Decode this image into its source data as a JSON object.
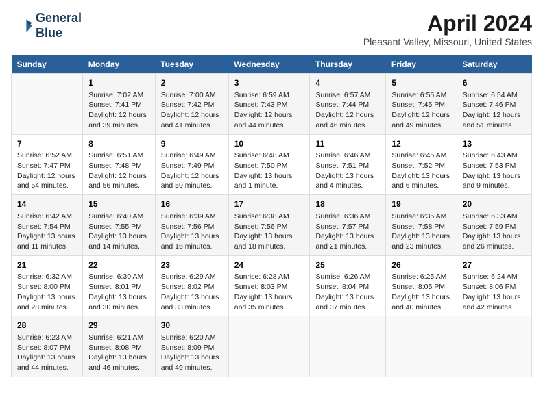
{
  "logo": {
    "line1": "General",
    "line2": "Blue"
  },
  "title": "April 2024",
  "subtitle": "Pleasant Valley, Missouri, United States",
  "headers": [
    "Sunday",
    "Monday",
    "Tuesday",
    "Wednesday",
    "Thursday",
    "Friday",
    "Saturday"
  ],
  "weeks": [
    [
      {
        "day": "",
        "sunrise": "",
        "sunset": "",
        "daylight": ""
      },
      {
        "day": "1",
        "sunrise": "Sunrise: 7:02 AM",
        "sunset": "Sunset: 7:41 PM",
        "daylight": "Daylight: 12 hours and 39 minutes."
      },
      {
        "day": "2",
        "sunrise": "Sunrise: 7:00 AM",
        "sunset": "Sunset: 7:42 PM",
        "daylight": "Daylight: 12 hours and 41 minutes."
      },
      {
        "day": "3",
        "sunrise": "Sunrise: 6:59 AM",
        "sunset": "Sunset: 7:43 PM",
        "daylight": "Daylight: 12 hours and 44 minutes."
      },
      {
        "day": "4",
        "sunrise": "Sunrise: 6:57 AM",
        "sunset": "Sunset: 7:44 PM",
        "daylight": "Daylight: 12 hours and 46 minutes."
      },
      {
        "day": "5",
        "sunrise": "Sunrise: 6:55 AM",
        "sunset": "Sunset: 7:45 PM",
        "daylight": "Daylight: 12 hours and 49 minutes."
      },
      {
        "day": "6",
        "sunrise": "Sunrise: 6:54 AM",
        "sunset": "Sunset: 7:46 PM",
        "daylight": "Daylight: 12 hours and 51 minutes."
      }
    ],
    [
      {
        "day": "7",
        "sunrise": "Sunrise: 6:52 AM",
        "sunset": "Sunset: 7:47 PM",
        "daylight": "Daylight: 12 hours and 54 minutes."
      },
      {
        "day": "8",
        "sunrise": "Sunrise: 6:51 AM",
        "sunset": "Sunset: 7:48 PM",
        "daylight": "Daylight: 12 hours and 56 minutes."
      },
      {
        "day": "9",
        "sunrise": "Sunrise: 6:49 AM",
        "sunset": "Sunset: 7:49 PM",
        "daylight": "Daylight: 12 hours and 59 minutes."
      },
      {
        "day": "10",
        "sunrise": "Sunrise: 6:48 AM",
        "sunset": "Sunset: 7:50 PM",
        "daylight": "Daylight: 13 hours and 1 minute."
      },
      {
        "day": "11",
        "sunrise": "Sunrise: 6:46 AM",
        "sunset": "Sunset: 7:51 PM",
        "daylight": "Daylight: 13 hours and 4 minutes."
      },
      {
        "day": "12",
        "sunrise": "Sunrise: 6:45 AM",
        "sunset": "Sunset: 7:52 PM",
        "daylight": "Daylight: 13 hours and 6 minutes."
      },
      {
        "day": "13",
        "sunrise": "Sunrise: 6:43 AM",
        "sunset": "Sunset: 7:53 PM",
        "daylight": "Daylight: 13 hours and 9 minutes."
      }
    ],
    [
      {
        "day": "14",
        "sunrise": "Sunrise: 6:42 AM",
        "sunset": "Sunset: 7:54 PM",
        "daylight": "Daylight: 13 hours and 11 minutes."
      },
      {
        "day": "15",
        "sunrise": "Sunrise: 6:40 AM",
        "sunset": "Sunset: 7:55 PM",
        "daylight": "Daylight: 13 hours and 14 minutes."
      },
      {
        "day": "16",
        "sunrise": "Sunrise: 6:39 AM",
        "sunset": "Sunset: 7:56 PM",
        "daylight": "Daylight: 13 hours and 16 minutes."
      },
      {
        "day": "17",
        "sunrise": "Sunrise: 6:38 AM",
        "sunset": "Sunset: 7:56 PM",
        "daylight": "Daylight: 13 hours and 18 minutes."
      },
      {
        "day": "18",
        "sunrise": "Sunrise: 6:36 AM",
        "sunset": "Sunset: 7:57 PM",
        "daylight": "Daylight: 13 hours and 21 minutes."
      },
      {
        "day": "19",
        "sunrise": "Sunrise: 6:35 AM",
        "sunset": "Sunset: 7:58 PM",
        "daylight": "Daylight: 13 hours and 23 minutes."
      },
      {
        "day": "20",
        "sunrise": "Sunrise: 6:33 AM",
        "sunset": "Sunset: 7:59 PM",
        "daylight": "Daylight: 13 hours and 26 minutes."
      }
    ],
    [
      {
        "day": "21",
        "sunrise": "Sunrise: 6:32 AM",
        "sunset": "Sunset: 8:00 PM",
        "daylight": "Daylight: 13 hours and 28 minutes."
      },
      {
        "day": "22",
        "sunrise": "Sunrise: 6:30 AM",
        "sunset": "Sunset: 8:01 PM",
        "daylight": "Daylight: 13 hours and 30 minutes."
      },
      {
        "day": "23",
        "sunrise": "Sunrise: 6:29 AM",
        "sunset": "Sunset: 8:02 PM",
        "daylight": "Daylight: 13 hours and 33 minutes."
      },
      {
        "day": "24",
        "sunrise": "Sunrise: 6:28 AM",
        "sunset": "Sunset: 8:03 PM",
        "daylight": "Daylight: 13 hours and 35 minutes."
      },
      {
        "day": "25",
        "sunrise": "Sunrise: 6:26 AM",
        "sunset": "Sunset: 8:04 PM",
        "daylight": "Daylight: 13 hours and 37 minutes."
      },
      {
        "day": "26",
        "sunrise": "Sunrise: 6:25 AM",
        "sunset": "Sunset: 8:05 PM",
        "daylight": "Daylight: 13 hours and 40 minutes."
      },
      {
        "day": "27",
        "sunrise": "Sunrise: 6:24 AM",
        "sunset": "Sunset: 8:06 PM",
        "daylight": "Daylight: 13 hours and 42 minutes."
      }
    ],
    [
      {
        "day": "28",
        "sunrise": "Sunrise: 6:23 AM",
        "sunset": "Sunset: 8:07 PM",
        "daylight": "Daylight: 13 hours and 44 minutes."
      },
      {
        "day": "29",
        "sunrise": "Sunrise: 6:21 AM",
        "sunset": "Sunset: 8:08 PM",
        "daylight": "Daylight: 13 hours and 46 minutes."
      },
      {
        "day": "30",
        "sunrise": "Sunrise: 6:20 AM",
        "sunset": "Sunset: 8:09 PM",
        "daylight": "Daylight: 13 hours and 49 minutes."
      },
      {
        "day": "",
        "sunrise": "",
        "sunset": "",
        "daylight": ""
      },
      {
        "day": "",
        "sunrise": "",
        "sunset": "",
        "daylight": ""
      },
      {
        "day": "",
        "sunrise": "",
        "sunset": "",
        "daylight": ""
      },
      {
        "day": "",
        "sunrise": "",
        "sunset": "",
        "daylight": ""
      }
    ]
  ]
}
